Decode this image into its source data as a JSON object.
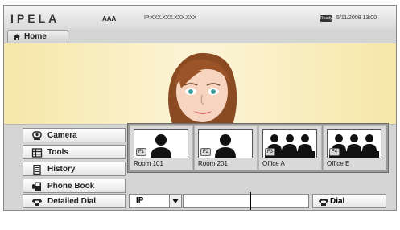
{
  "topbar": {
    "logo": "IPELA",
    "system_name": "AAA",
    "ip_address": "IP:XXX.XXX.XXX.XXX",
    "status_badge": "Ready",
    "datetime": "5/11/2008  13:00"
  },
  "home_tab": {
    "label": "Home"
  },
  "menu": {
    "items": [
      {
        "label": "Camera",
        "icon": "camera-icon"
      },
      {
        "label": "Tools",
        "icon": "tools-icon"
      },
      {
        "label": "History",
        "icon": "history-icon"
      },
      {
        "label": "Phone Book",
        "icon": "phone-book-icon"
      },
      {
        "label": "Detailed Dial",
        "icon": "detailed-dial-icon"
      }
    ]
  },
  "phonebook_thumbs": [
    {
      "key": "F1",
      "name": "Room 101",
      "people": 1
    },
    {
      "key": "F2",
      "name": "Room 201",
      "people": 1
    },
    {
      "key": "F3",
      "name": "Office A",
      "people": 3
    },
    {
      "key": "F4",
      "name": "Office E",
      "people": 3
    }
  ],
  "dial_bar": {
    "protocol_value": "IP",
    "dial_input_value": "",
    "dial_button_label": "Dial"
  },
  "colors": {
    "background_bar": "#d4d4d4",
    "stage_gradient": "#f6e7a8",
    "thumb_tray": "#9a9a9a"
  }
}
